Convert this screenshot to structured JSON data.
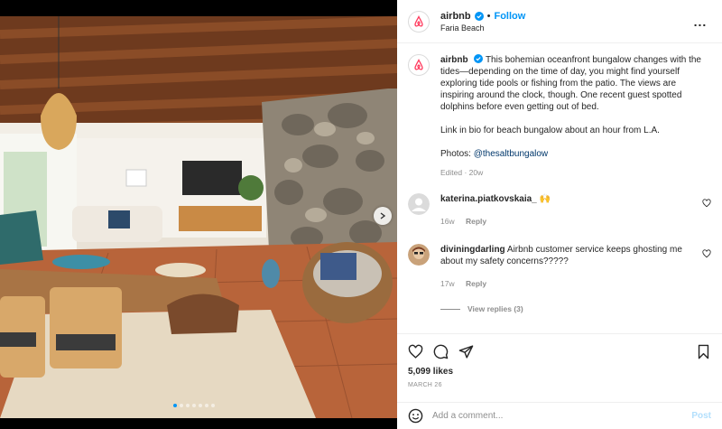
{
  "account": {
    "username": "airbnb",
    "follow_label": "Follow",
    "separator": "•",
    "location": "Faria Beach"
  },
  "header": {
    "more_label": "..."
  },
  "caption": {
    "username": "airbnb",
    "paragraph1": "This bohemian oceanfront bungalow changes with the tides—depending on the time of day, you might find yourself exploring tide pools or fishing from the patio. The views are inspiring around the clock, though. One recent guest spotted dolphins before even getting out of bed.",
    "paragraph2": "Link in bio for beach bungalow about an hour from L.A.",
    "photos_prefix": "Photos:",
    "photos_mention": "@thesaltbungalow",
    "edited": "Edited · 20w"
  },
  "comments": [
    {
      "username": "katerina.piatkovskaia_",
      "text": "🙌",
      "age": "16w",
      "reply_label": "Reply"
    },
    {
      "username": "diviningdarling",
      "text": "Airbnb customer service keeps ghosting me about my safety concerns?????",
      "age": "17w",
      "reply_label": "Reply",
      "view_replies": "View replies (3)"
    }
  ],
  "likes": "5,099 likes",
  "date": "MARCH 26",
  "add_comment": {
    "placeholder": "Add a comment...",
    "post_label": "Post"
  },
  "carousel": {
    "count": 7,
    "active": 0
  },
  "colors": {
    "brand": "#ff385c",
    "link": "#0095f6",
    "muted": "#8e8e8e"
  }
}
